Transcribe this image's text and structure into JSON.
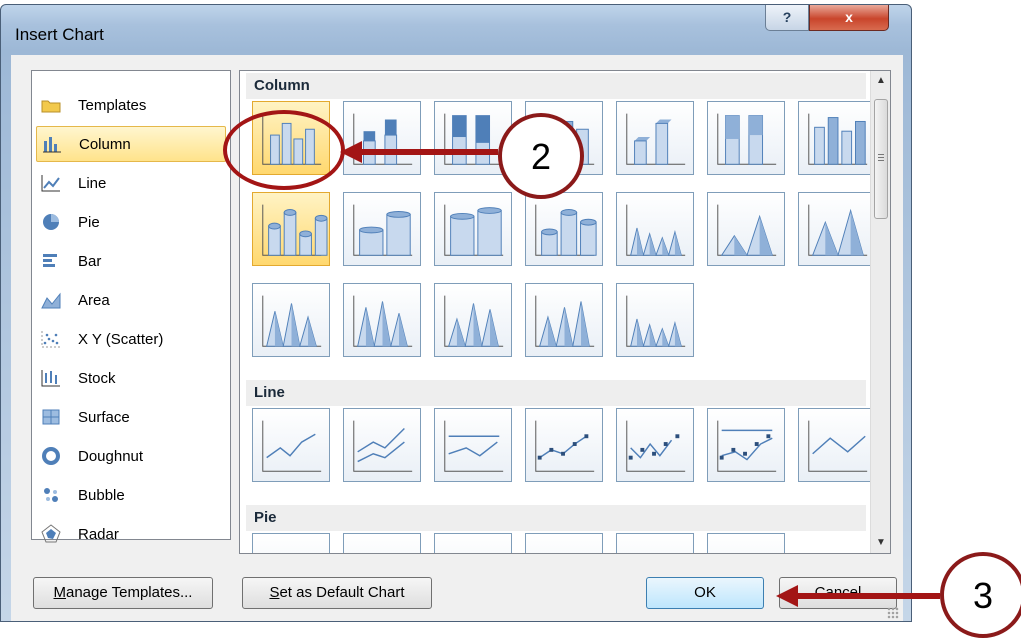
{
  "dialog": {
    "title": "Insert Chart",
    "help_glyph": "?",
    "close_glyph": "x"
  },
  "categories": [
    {
      "label": "Templates",
      "icon": "folder-icon"
    },
    {
      "label": "Column",
      "icon": "column-chart-icon",
      "selected": true
    },
    {
      "label": "Line",
      "icon": "line-chart-icon"
    },
    {
      "label": "Pie",
      "icon": "pie-chart-icon"
    },
    {
      "label": "Bar",
      "icon": "bar-chart-icon"
    },
    {
      "label": "Area",
      "icon": "area-chart-icon"
    },
    {
      "label": "X Y (Scatter)",
      "icon": "scatter-chart-icon"
    },
    {
      "label": "Stock",
      "icon": "stock-chart-icon"
    },
    {
      "label": "Surface",
      "icon": "surface-chart-icon"
    },
    {
      "label": "Doughnut",
      "icon": "doughnut-chart-icon"
    },
    {
      "label": "Bubble",
      "icon": "bubble-chart-icon"
    },
    {
      "label": "Radar",
      "icon": "radar-chart-icon"
    }
  ],
  "gallery": {
    "sections": [
      {
        "label": "Column",
        "thumbnail_count": 19
      },
      {
        "label": "Line",
        "thumbnail_count": 7
      },
      {
        "label": "Pie",
        "thumbnail_count": 6
      }
    ]
  },
  "buttons": {
    "manage_templates": {
      "label": "Manage Templates...",
      "mnemonic": "M",
      "rest": "anage Templates..."
    },
    "set_default": {
      "label": "Set as Default Chart",
      "mnemonic": "S",
      "rest": "et as Default Chart"
    },
    "ok": "OK",
    "cancel": "Cancel"
  },
  "annotations": [
    {
      "number": "2"
    },
    {
      "number": "3"
    }
  ],
  "colors": {
    "accent_red": "#a31515",
    "selection_gold": "#ffd86f",
    "chart_blue": "#4f7fb8"
  }
}
